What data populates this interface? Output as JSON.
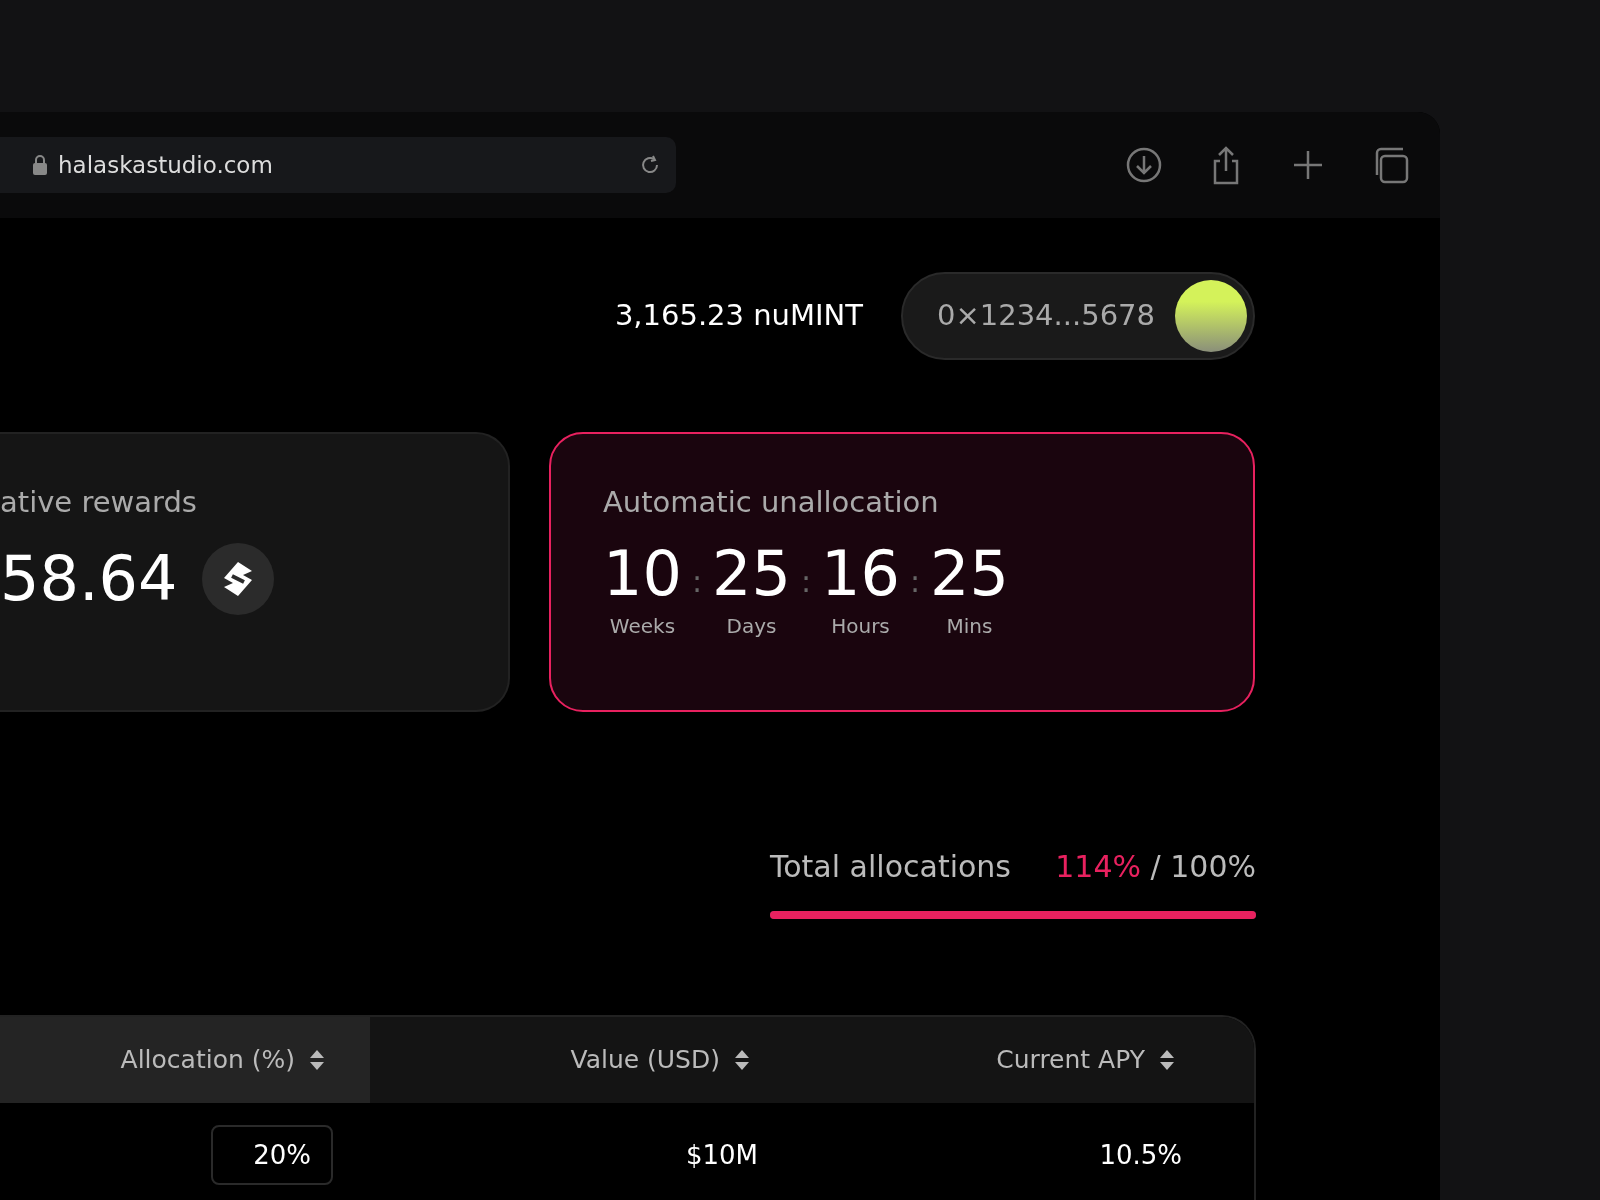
{
  "browser": {
    "url": "halaskastudio.com"
  },
  "header": {
    "balance": "3,165.23 nuMINT",
    "wallet_address": "0×1234...5678"
  },
  "rewards_card": {
    "title": "ative rewards",
    "value": "58.64"
  },
  "countdown_card": {
    "title": "Automatic unallocation",
    "separator": ":",
    "units": [
      {
        "value": "10",
        "label": "Weeks"
      },
      {
        "value": "25",
        "label": "Days"
      },
      {
        "value": "16",
        "label": "Hours"
      },
      {
        "value": "25",
        "label": "Mins"
      }
    ]
  },
  "allocations": {
    "label": "Total allocations",
    "current": "114%",
    "total": "/ 100%",
    "level": 1
  },
  "table": {
    "columns": [
      {
        "label": "Allocation (%)",
        "selected": true
      },
      {
        "label": "Value (USD)",
        "selected": false
      },
      {
        "label": "Current APY",
        "selected": false
      }
    ],
    "rows": [
      {
        "allocation": "20%",
        "value": "$10M",
        "apy": "10.5%"
      }
    ]
  }
}
